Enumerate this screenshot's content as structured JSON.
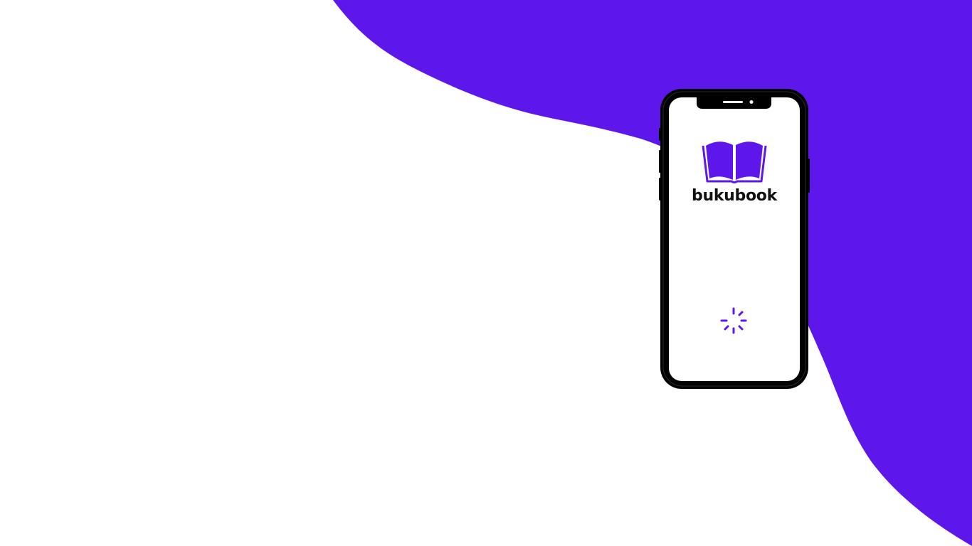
{
  "app": {
    "name": "bukubook"
  },
  "colors": {
    "brand": "#5e17eb",
    "phone_frame": "#000000",
    "screen": "#ffffff",
    "text": "#111111"
  },
  "icons": {
    "logo": "open-book-icon",
    "loading": "loading-spinner-icon"
  }
}
